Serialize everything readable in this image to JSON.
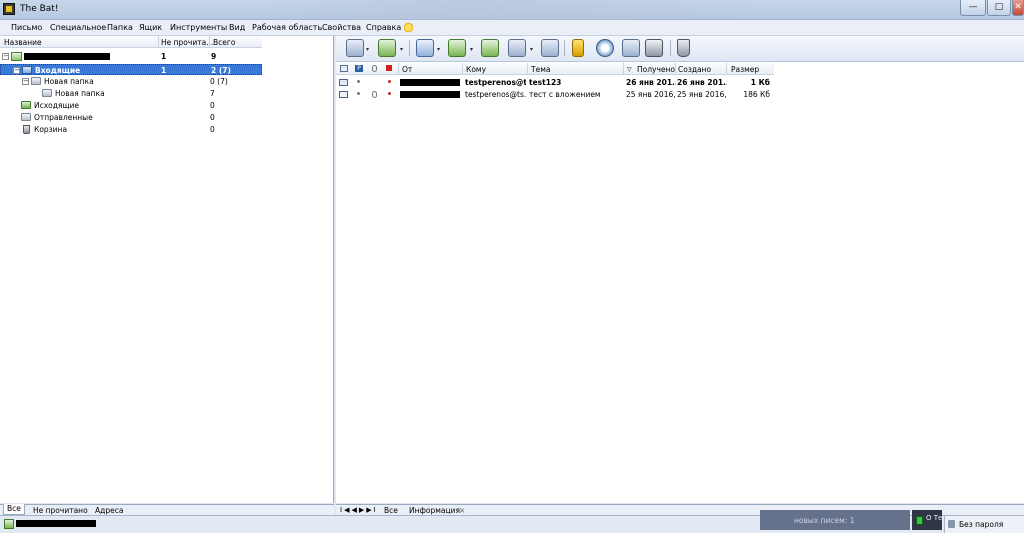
{
  "window": {
    "title": "The Bat!",
    "min": "—",
    "max": "□",
    "close": "✕"
  },
  "menu": [
    "Письмо",
    "Специальное",
    "Папка",
    "Ящик",
    "Инструменты",
    "Вид",
    "Рабочая область",
    "Свойства",
    "Справка"
  ],
  "folders": {
    "columns": {
      "name": "Название",
      "unread": "Не прочита...",
      "total": "Всего"
    },
    "account": {
      "unread": "1",
      "total": "9"
    },
    "items": [
      {
        "name": "Входящие",
        "unread": "1",
        "total": "2 (7)",
        "selected": true
      },
      {
        "name": "Новая папка",
        "unread": "",
        "total": "0 (7)"
      },
      {
        "name": "Новая папка",
        "unread": "",
        "total": "7"
      },
      {
        "name": "Исходящие",
        "unread": "",
        "total": "0"
      },
      {
        "name": "Отправленные",
        "unread": "",
        "total": "0"
      },
      {
        "name": "Корзина",
        "unread": "",
        "total": "0"
      }
    ],
    "tabs": [
      "Все",
      "Не прочитано",
      "Адреса"
    ]
  },
  "messages": {
    "columns": {
      "from": "От",
      "to": "Кому",
      "subject": "Тема",
      "received": "Получено",
      "created": "Создано",
      "size": "Размер"
    },
    "rows": [
      {
        "to": "testperenos@t...",
        "subject": "test123",
        "received": "26 янв 201...",
        "created": "26 янв 201...",
        "size": "1 Кб",
        "unread": true
      },
      {
        "to": "testperenos@ts...",
        "subject": "тест с вложением",
        "received": "25 янв 2016, ...",
        "created": "25 янв 2016, ...",
        "size": "186 Кб",
        "unread": false
      }
    ],
    "tabs": [
      "Все",
      "Информация"
    ],
    "tab_close": "×",
    "nav_arrows": "I◀◀▶▶I"
  },
  "status": {
    "new_messages": "новых писем: 1",
    "truncated": "О Тем",
    "password": "Без пароля"
  },
  "toolbar": {
    "dropdown_glyph": "▾"
  },
  "colors": {
    "selection": "#3a79d8",
    "accent": "#2c5da8"
  }
}
